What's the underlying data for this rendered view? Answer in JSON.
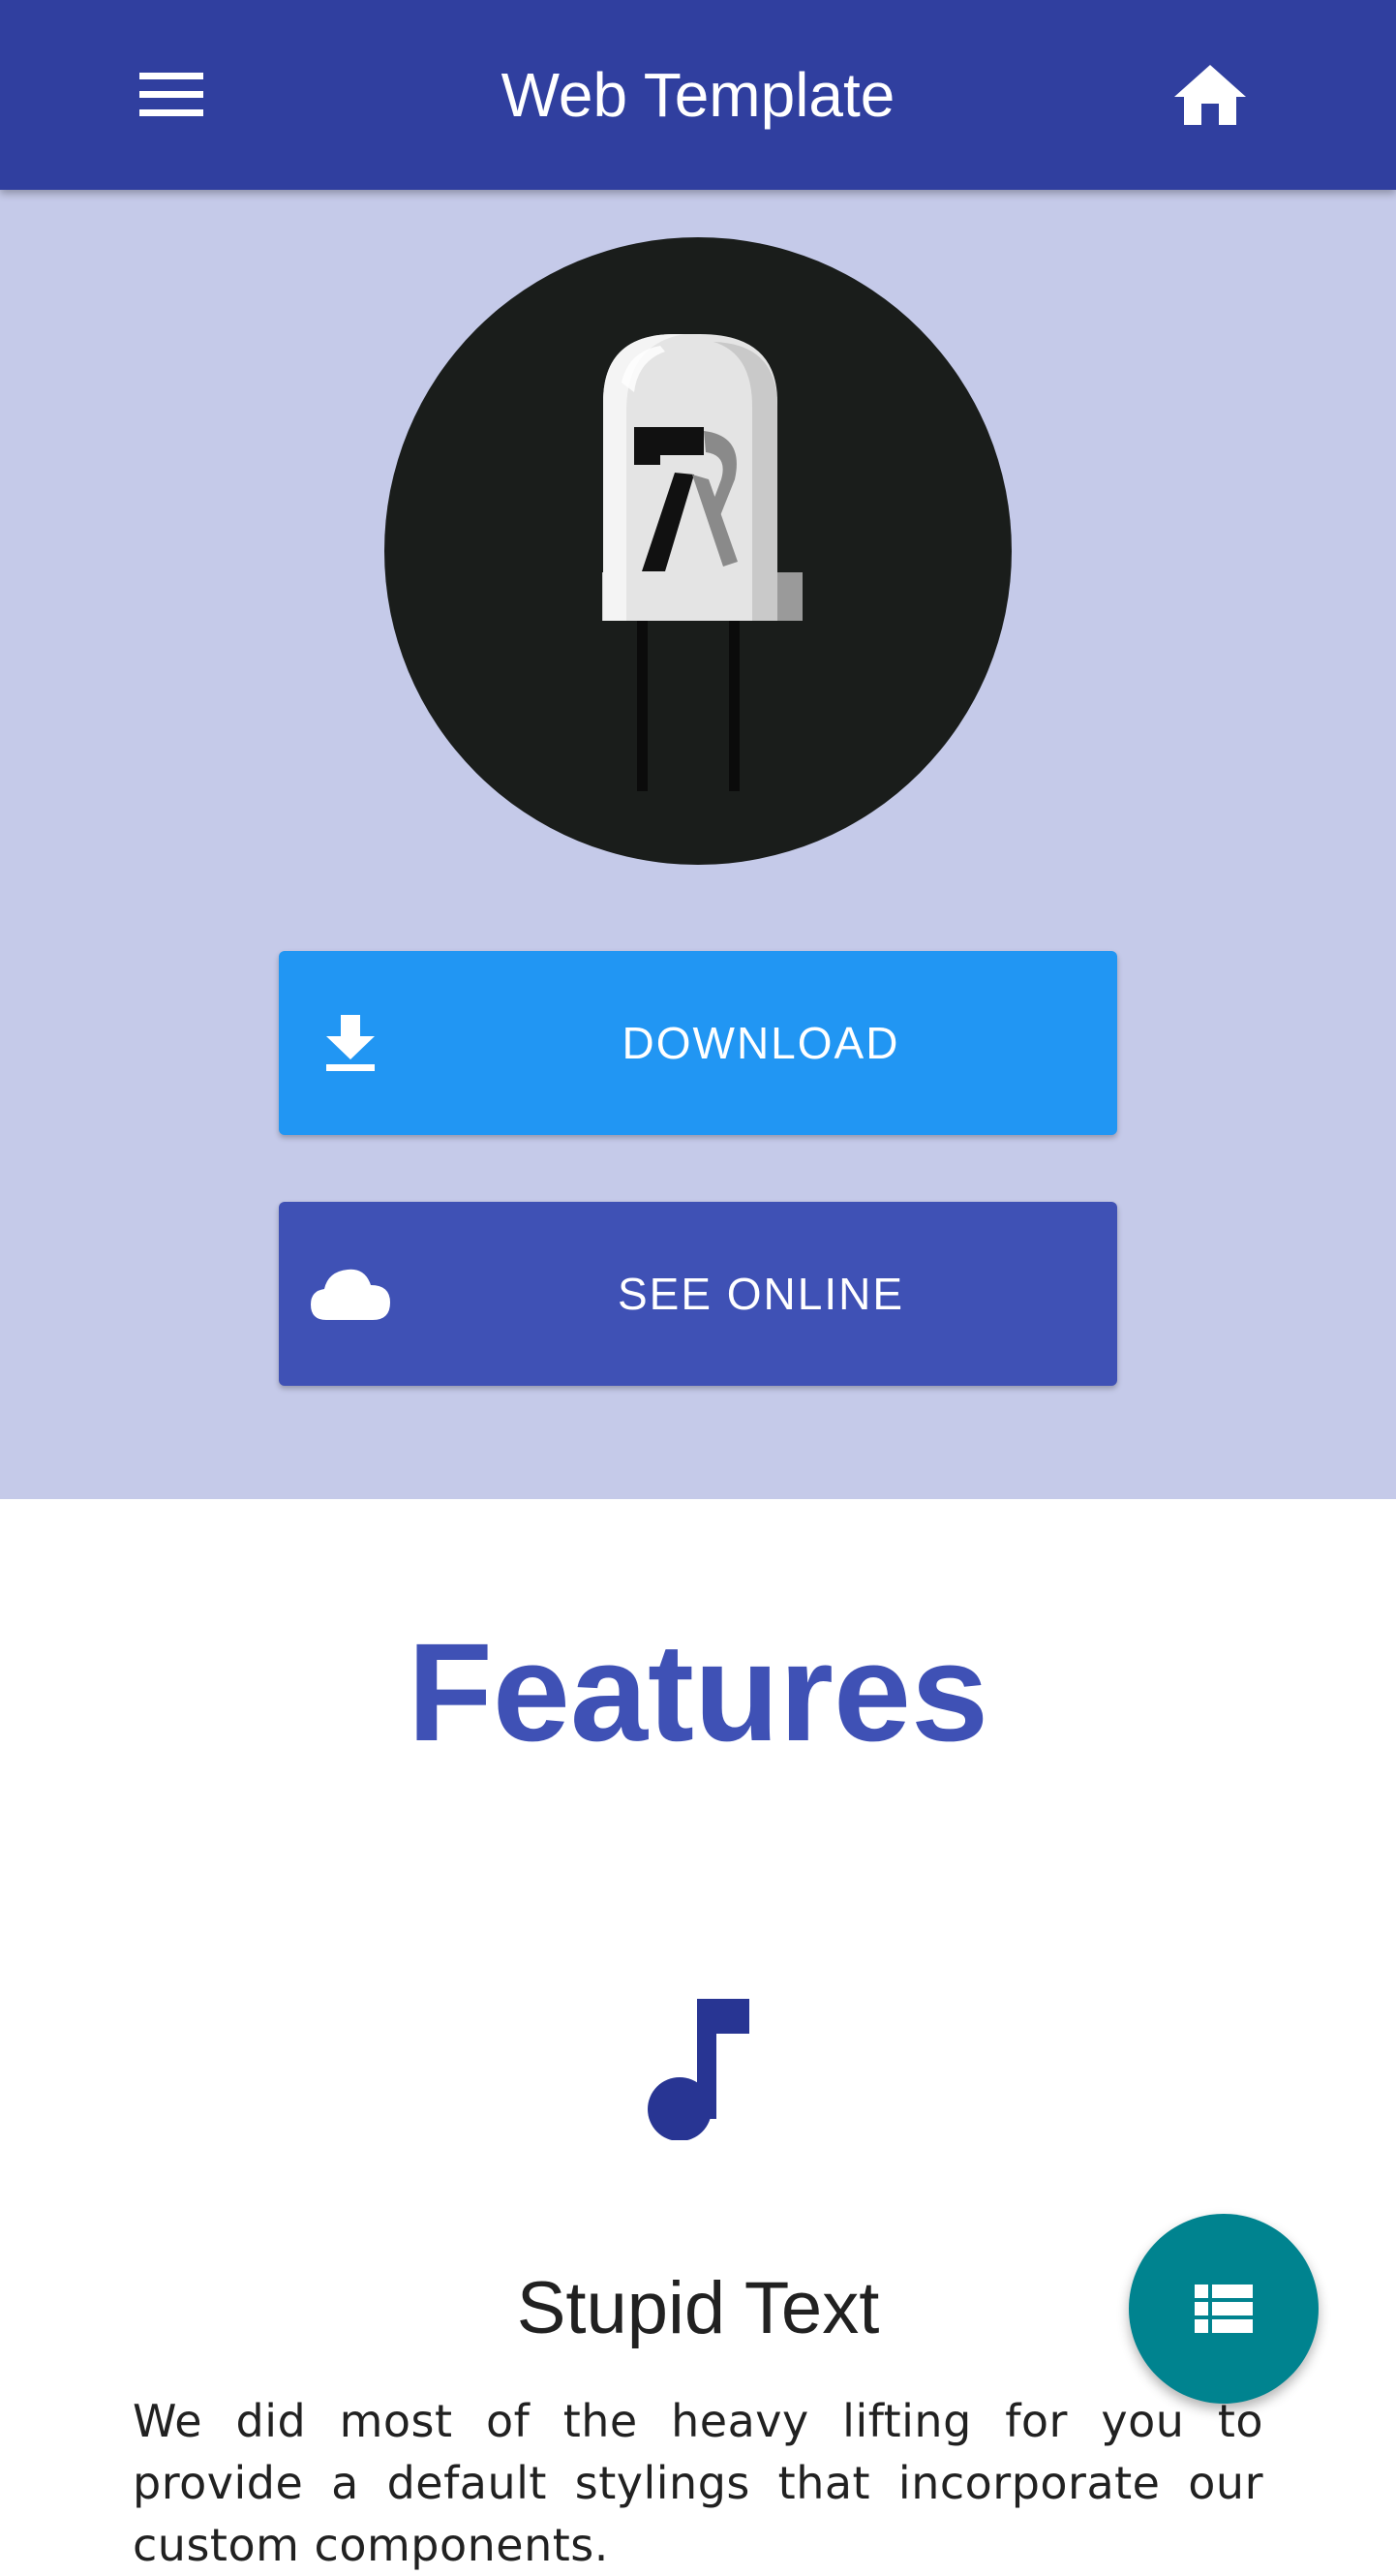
{
  "app_bar": {
    "title": "Web Template",
    "menu_icon": "menu-icon",
    "home_icon": "home-icon",
    "color": "#303f9f"
  },
  "hero": {
    "background": "#c5cae9",
    "logo": "led-logo",
    "buttons": [
      {
        "label": "DOWNLOAD",
        "icon": "download-icon",
        "color": "#2196f3"
      },
      {
        "label": "SEE ONLINE",
        "icon": "cloud-icon",
        "color": "#3f51b5"
      }
    ]
  },
  "features": {
    "heading": "Features",
    "items": [
      {
        "icon": "music-note-icon",
        "title": "Stupid Text",
        "text": "We did most of the heavy lifting for you to provide a default stylings that incorporate our custom components."
      }
    ]
  },
  "fab": {
    "icon": "list-view-icon",
    "color": "#00838f"
  }
}
